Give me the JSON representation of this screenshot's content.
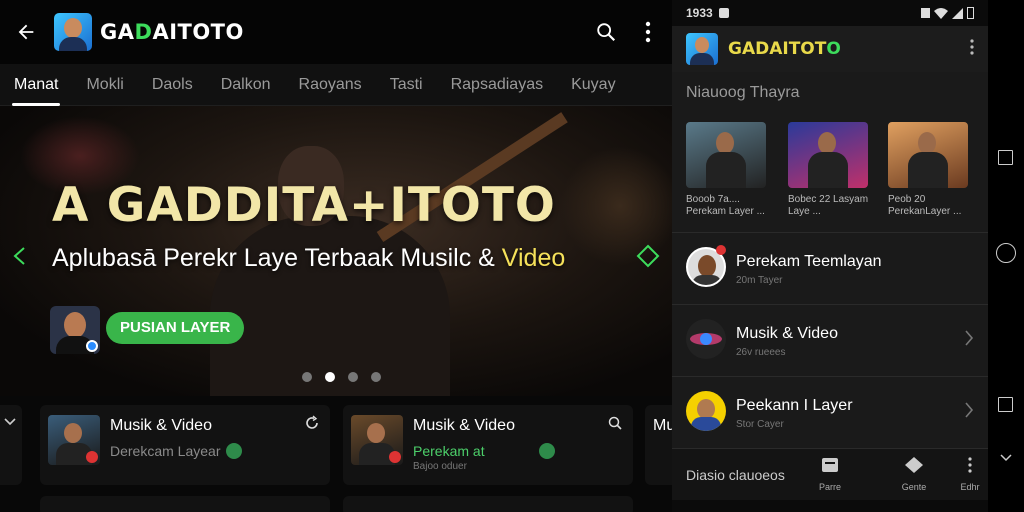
{
  "app": {
    "brand_prefix": "GA",
    "brand_accent": "D",
    "brand_suffix": "AITOTO",
    "brand_colors": {
      "text": "#ffffff",
      "accent": "#3ddc5c",
      "primary_green": "#39b54a"
    }
  },
  "tabs": [
    {
      "label": "Manat",
      "active": true
    },
    {
      "label": "Mokli",
      "active": false
    },
    {
      "label": "Daols",
      "active": false
    },
    {
      "label": "Dalkon",
      "active": false
    },
    {
      "label": "Raoyans",
      "active": false
    },
    {
      "label": "Tasti",
      "active": false
    },
    {
      "label": "Rapsadiayas",
      "active": false
    },
    {
      "label": "Kuyay",
      "active": false
    }
  ],
  "hero": {
    "title": "A GADDITA+ITOTO",
    "subtitle_main": "Aplubasā Perekr Laye Terbaak Musilc & ",
    "subtitle_highlight": "Video",
    "button_label": "PUSIAN LAYER",
    "dots_total": 4,
    "dots_active_index": 1
  },
  "cards": [
    {
      "title": "Musik & Video",
      "line1": "Derekcam Layear",
      "line2": ""
    },
    {
      "title": "Musik & Video",
      "line1": "Perekam at",
      "line2": "Bajoo oduer"
    },
    {
      "title": "Mu",
      "line1": "",
      "line2": ""
    }
  ],
  "panel": {
    "status_time": "1933",
    "brand": "GADAITOT",
    "brand_end": "O",
    "section_title": "Niauoog Thayra",
    "thumbs": [
      {
        "caption": "Booob 7a.... Perekam Layer ..."
      },
      {
        "caption": "Bobec 22 Lasyam Laye ..."
      },
      {
        "caption": "Peob 20 PerekanLayer ..."
      }
    ],
    "list": [
      {
        "title": "Perekam Teemlayan",
        "subtitle": "20m Tayer"
      },
      {
        "title": "Musik & Video",
        "subtitle": "26v rueees"
      },
      {
        "title": "Peekann I Layer",
        "subtitle": "Stor Cayer"
      }
    ],
    "bottom_label": "Diasio clauoeos",
    "nav": [
      {
        "label": "Parre"
      },
      {
        "label": "Gente"
      },
      {
        "label": "Edhr"
      }
    ]
  }
}
